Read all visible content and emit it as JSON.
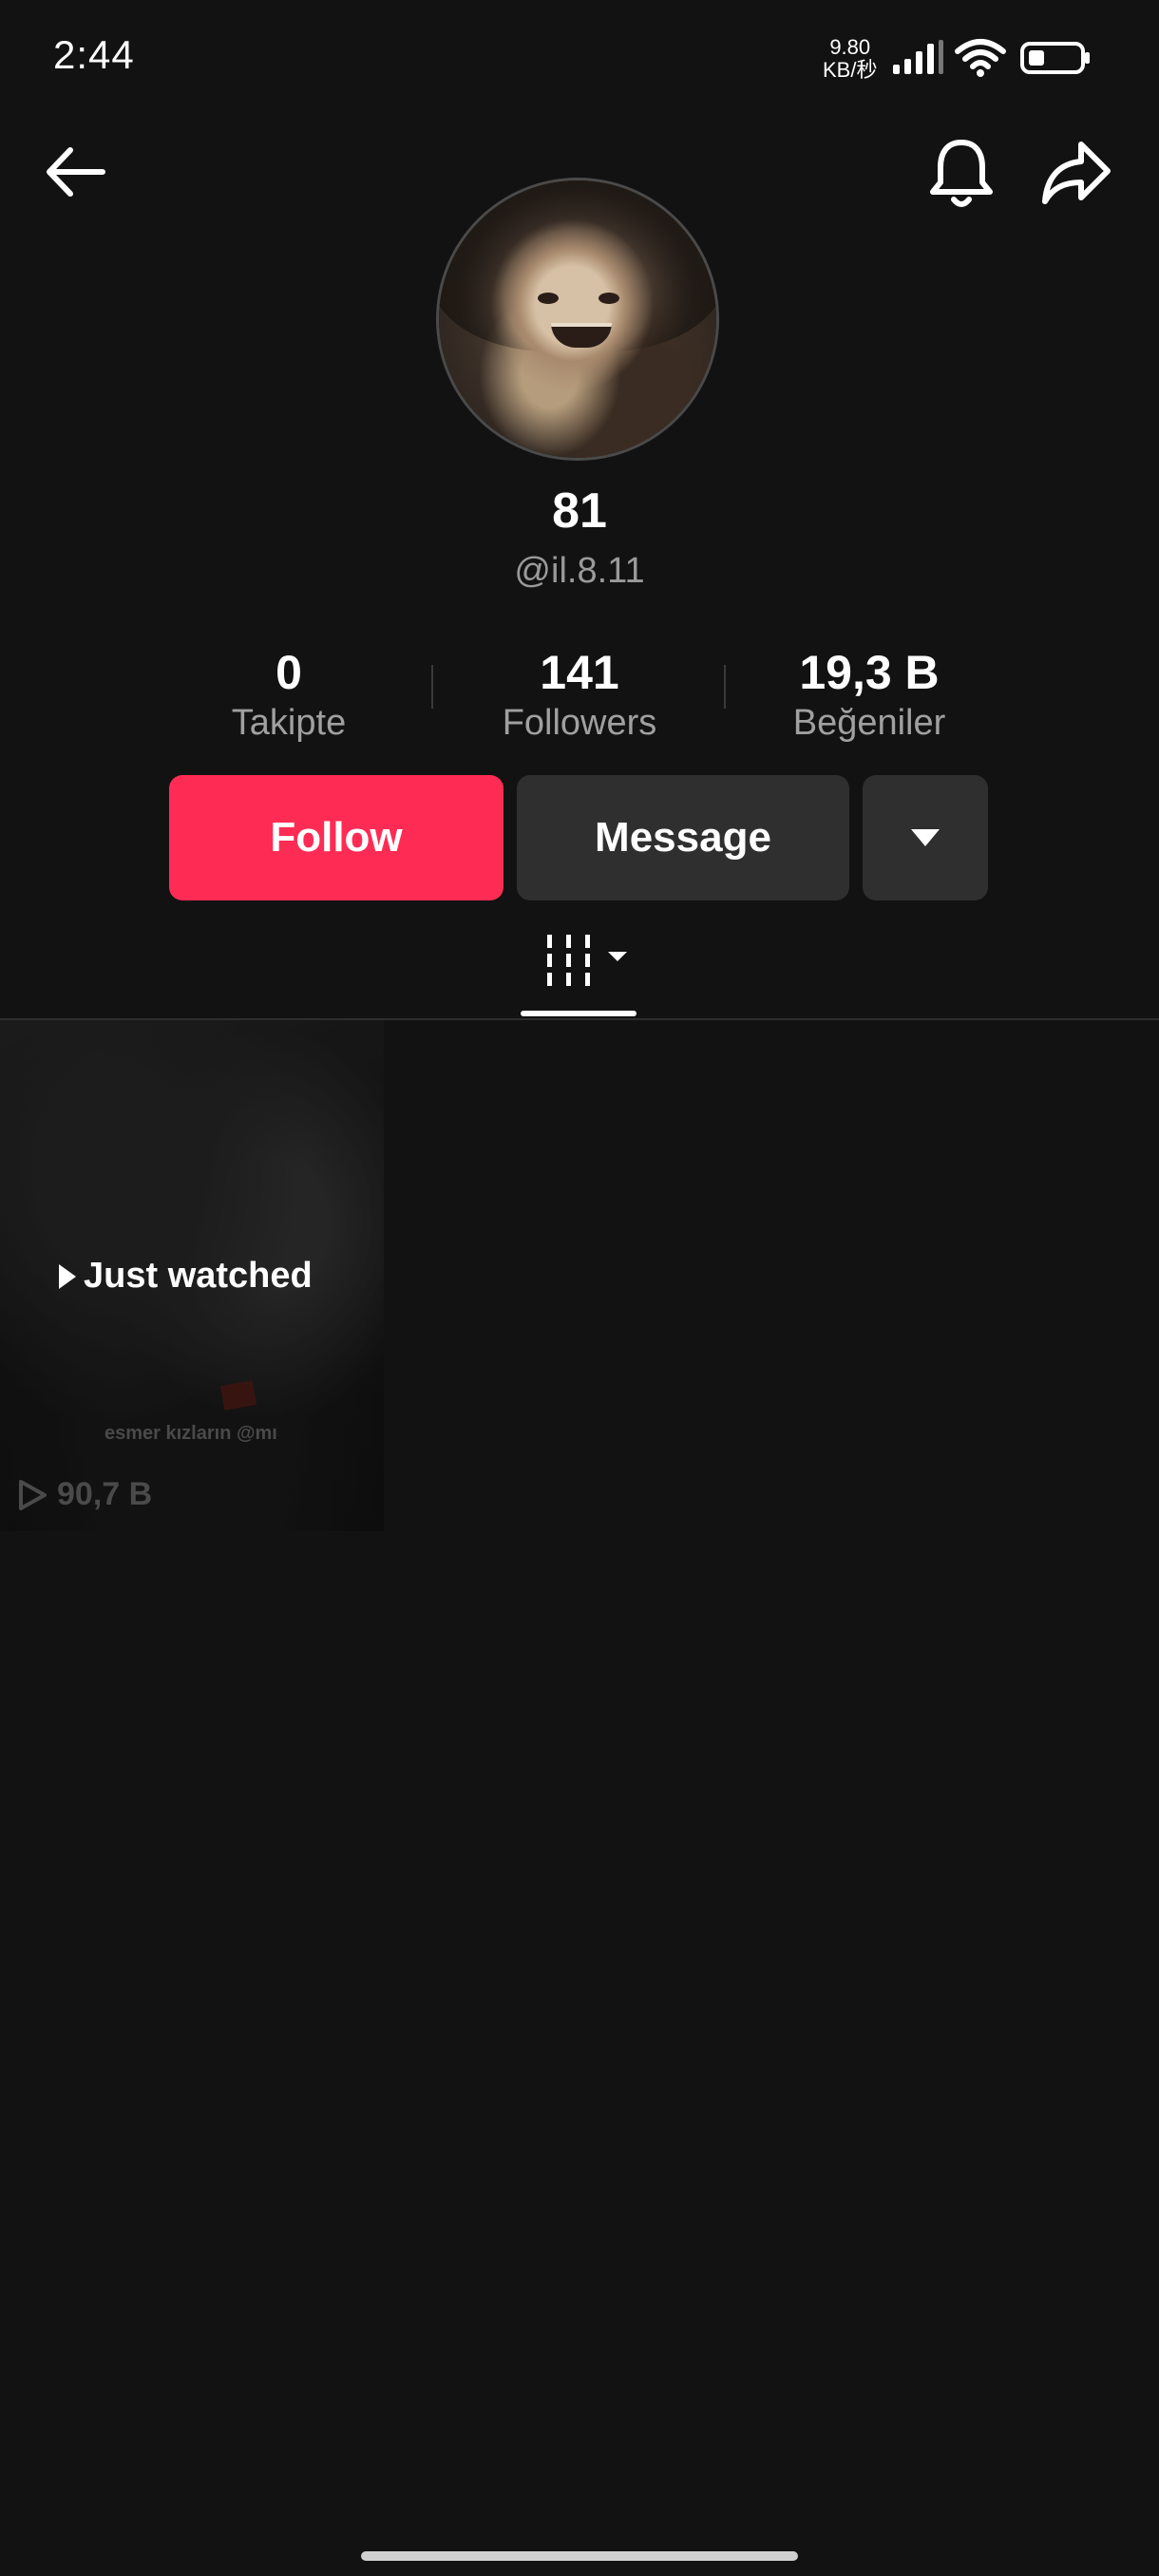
{
  "status_bar": {
    "time": "2:44",
    "net_speed_value": "9.80",
    "net_speed_unit": "KB/秒",
    "icons": [
      "signal-icon",
      "wifi-icon",
      "battery-icon"
    ]
  },
  "nav": {
    "icons": [
      "back-arrow-icon",
      "bell-icon",
      "share-icon"
    ]
  },
  "profile": {
    "display_name": "81",
    "username": "@il.8.11"
  },
  "stats": [
    {
      "value": "0",
      "label": "Takipte"
    },
    {
      "value": "141",
      "label": "Followers"
    },
    {
      "value": "19,3 B",
      "label": "Beğeniler"
    }
  ],
  "actions": {
    "follow_label": "Follow",
    "message_label": "Message"
  },
  "colors": {
    "background": "#121212",
    "follow_button": "#fe2c55",
    "secondary_button": "#2f2f2f"
  },
  "videos": [
    {
      "badge": "Just watched",
      "caption": "esmer kızların @mı",
      "views": "90,7 B"
    }
  ]
}
